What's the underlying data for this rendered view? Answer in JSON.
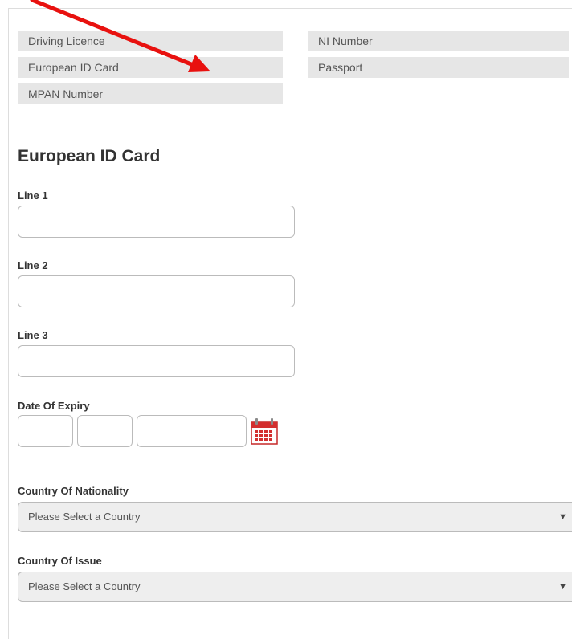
{
  "id_types": {
    "left": [
      "Driving Licence",
      "European ID Card",
      "MPAN Number"
    ],
    "right": [
      "NI Number",
      "Passport"
    ]
  },
  "form": {
    "title": "European ID Card",
    "line1_label": "Line 1",
    "line2_label": "Line 2",
    "line3_label": "Line 3",
    "line1_value": "",
    "line2_value": "",
    "line3_value": "",
    "expiry_label": "Date Of Expiry",
    "expiry_day": "",
    "expiry_month": "",
    "expiry_year": "",
    "nationality_label": "Country Of Nationality",
    "nationality_value": "Please Select a Country",
    "issue_label": "Country Of Issue",
    "issue_value": "Please Select a Country",
    "caret": "▼"
  },
  "colors": {
    "annotation_arrow": "#e8110f",
    "calendar_icon": "#d32f2f",
    "button_bg": "#e6e6e6"
  },
  "icons": [
    "calendar-icon",
    "dropdown-caret-icon",
    "annotation-arrow"
  ]
}
